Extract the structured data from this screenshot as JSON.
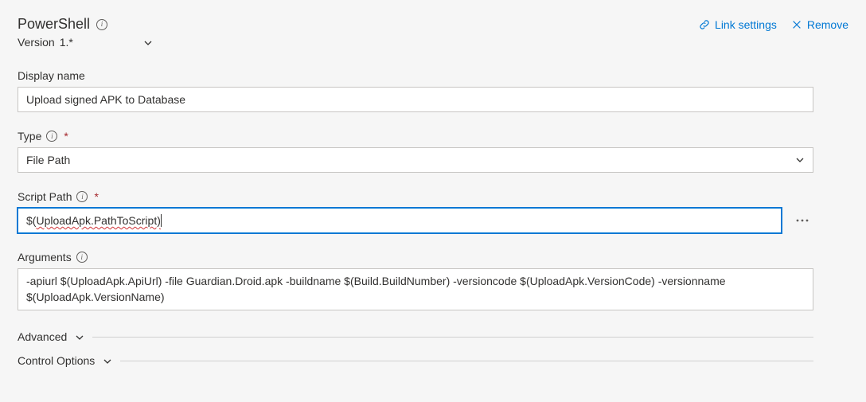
{
  "header": {
    "title": "PowerShell",
    "link_settings": "Link settings",
    "remove": "Remove"
  },
  "version": {
    "label": "Version",
    "value": "1.*"
  },
  "fields": {
    "display_name": {
      "label": "Display name",
      "value": "Upload signed APK to Database"
    },
    "type": {
      "label": "Type",
      "value": "File Path"
    },
    "script_path": {
      "label": "Script Path",
      "prefix": "$(",
      "squiggle": "UploadApk.PathToScript)",
      "suffix": ""
    },
    "arguments": {
      "label": "Arguments",
      "value": "-apiurl $(UploadApk.ApiUrl) -file Guardian.Droid.apk -buildname $(Build.BuildNumber) -versioncode $(UploadApk.VersionCode) -versionname $(UploadApk.VersionName)"
    }
  },
  "sections": {
    "advanced": "Advanced",
    "control": "Control Options"
  }
}
